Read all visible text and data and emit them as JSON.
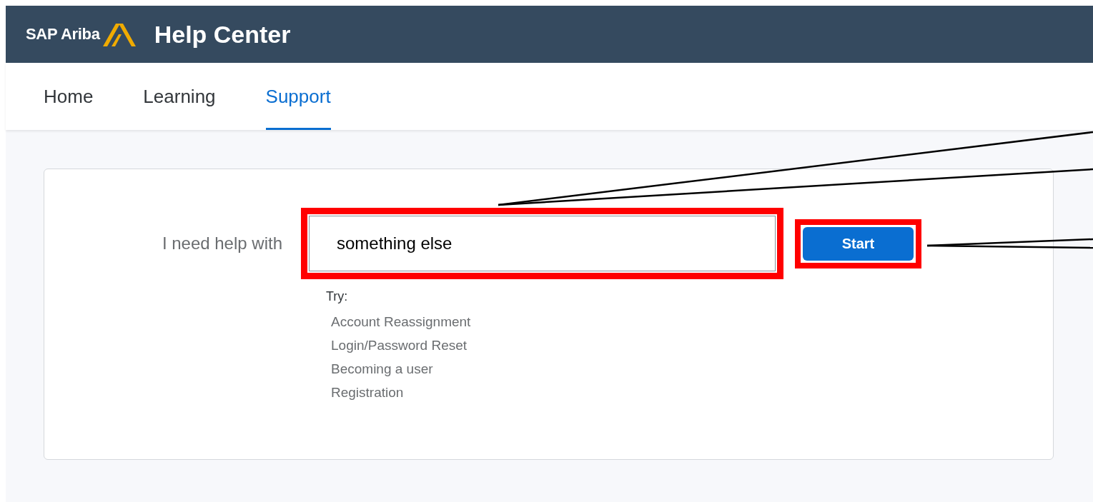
{
  "header": {
    "brand": "SAP Ariba",
    "title": "Help Center"
  },
  "tabs": [
    {
      "label": "Home",
      "selected": false
    },
    {
      "label": "Learning",
      "selected": false
    },
    {
      "label": "Support",
      "selected": true
    }
  ],
  "help_form": {
    "label": "I need help with",
    "value": "something else",
    "button": "Start",
    "try_label": "Try:",
    "suggestions": [
      "Account Reassignment",
      "Login/Password Reset",
      "Becoming a user",
      "Registration"
    ]
  }
}
